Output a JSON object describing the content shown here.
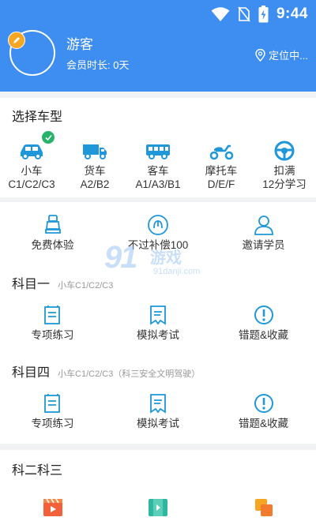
{
  "status": {
    "time": "9:44"
  },
  "user": {
    "name": "游客",
    "member_duration": "会员时长: 0天",
    "location": "定位中..."
  },
  "vehicle_section": {
    "title": "选择车型",
    "items": [
      {
        "name": "小车",
        "codes": "C1/C2/C3",
        "selected": true
      },
      {
        "name": "货车",
        "codes": "A2/B2"
      },
      {
        "name": "客车",
        "codes": "A1/A3/B1"
      },
      {
        "name": "摩托车",
        "codes": "D/E/F"
      },
      {
        "name": "扣满",
        "codes": "12分学习"
      }
    ]
  },
  "promo": {
    "items": [
      {
        "label": "免费体验"
      },
      {
        "label": "不过补偿100"
      },
      {
        "label": "邀请学员"
      }
    ]
  },
  "subject1": {
    "title": "科目一",
    "sub": "小车C1/C2/C3",
    "items": [
      {
        "label": "专项练习"
      },
      {
        "label": "模拟考试"
      },
      {
        "label": "错题&收藏"
      }
    ]
  },
  "subject4": {
    "title": "科目四",
    "sub": "小车C1/C2/C3（科三安全文明驾驶）",
    "items": [
      {
        "label": "专项练习"
      },
      {
        "label": "模拟考试"
      },
      {
        "label": "错题&收藏"
      }
    ]
  },
  "subject23": {
    "title": "科二科三"
  },
  "watermark": {
    "brand_num": "91",
    "brand_cn": "游戏",
    "url": "91danji.com"
  },
  "colors": {
    "header": "#3d8ef0",
    "accent": "#1f97d9",
    "orange": "#f5a623",
    "check": "#27b36a"
  }
}
